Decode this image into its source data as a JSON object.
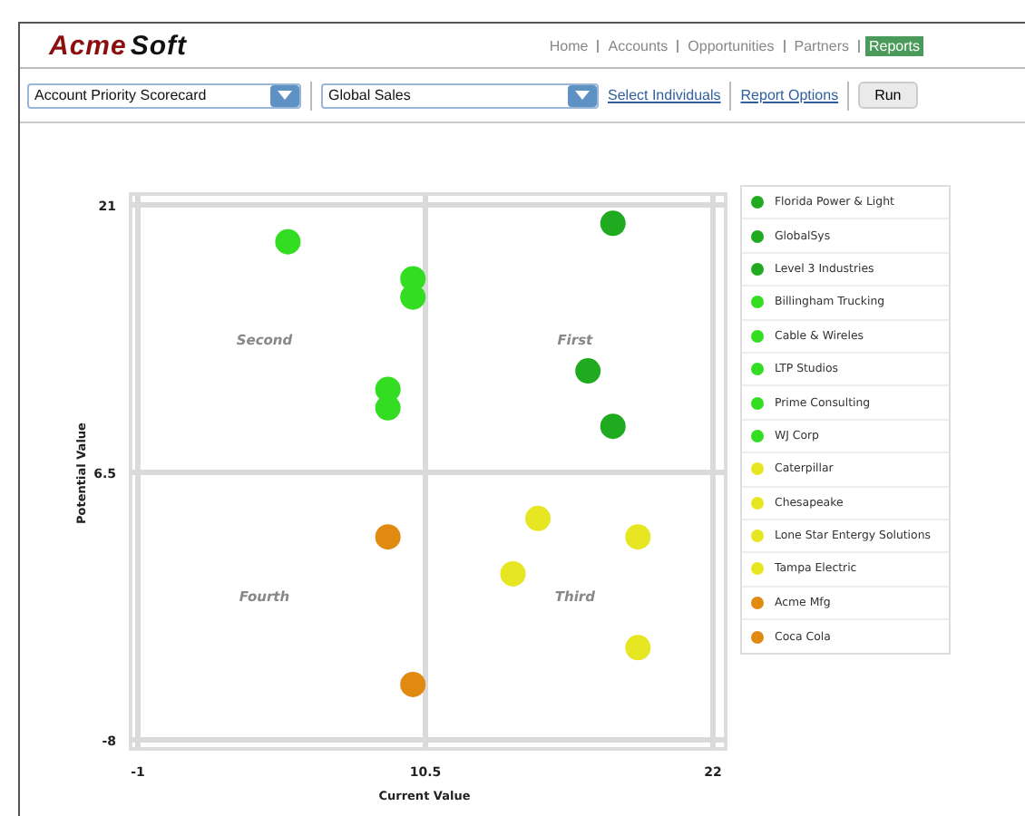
{
  "header": {
    "logo": [
      "Acme",
      "Soft"
    ],
    "nav": [
      {
        "label": "Home",
        "selected": false
      },
      {
        "label": "Accounts",
        "selected": false
      },
      {
        "label": "Opportunities",
        "selected": false
      },
      {
        "label": "Partners",
        "selected": false
      },
      {
        "label": "Reports",
        "selected": true
      }
    ]
  },
  "toolbar": {
    "report_select": {
      "value": "Account Priority Scorecard"
    },
    "scope_select": {
      "value": "Global Sales"
    },
    "links": [
      "Select Individuals",
      "Report Options"
    ],
    "run_button": "Run"
  },
  "chart_data": {
    "type": "scatter",
    "xlabel": "Current Value",
    "ylabel": "Potential Value",
    "xlim": [
      -1,
      22
    ],
    "ylim": [
      -8,
      21
    ],
    "xticks": [
      -1,
      10.5,
      22
    ],
    "yticks": [
      -8,
      6.5,
      21
    ],
    "annotations": [
      "Second",
      "First",
      "Fourth",
      "Third"
    ],
    "series": [
      {
        "name": "Florida Power & Light",
        "color": "#1faa1f",
        "x": [
          18
        ],
        "values": [
          20
        ]
      },
      {
        "name": "GlobalSys",
        "color": "#1faa1f",
        "x": [
          17
        ],
        "values": [
          12
        ]
      },
      {
        "name": "Level 3 Industries",
        "color": "#1faa1f",
        "x": [
          18
        ],
        "values": [
          9
        ]
      },
      {
        "name": "Billingham Trucking",
        "color": "#33dd22",
        "x": [
          5
        ],
        "values": [
          19
        ]
      },
      {
        "name": "Cable & Wireles",
        "color": "#33dd22",
        "x": [
          10
        ],
        "values": [
          17
        ]
      },
      {
        "name": "LTP Studios",
        "color": "#33dd22",
        "x": [
          10
        ],
        "values": [
          16
        ]
      },
      {
        "name": "Prime Consulting",
        "color": "#33dd22",
        "x": [
          9
        ],
        "values": [
          11
        ]
      },
      {
        "name": "WJ Corp",
        "color": "#33dd22",
        "x": [
          9
        ],
        "values": [
          10
        ]
      },
      {
        "name": "Caterpillar",
        "color": "#e6e622",
        "x": [
          15
        ],
        "values": [
          4
        ]
      },
      {
        "name": "Chesapeake",
        "color": "#e6e622",
        "x": [
          19
        ],
        "values": [
          3
        ]
      },
      {
        "name": "Lone Star Entergy Solutions",
        "color": "#e6e622",
        "x": [
          14
        ],
        "values": [
          1
        ]
      },
      {
        "name": "Tampa Electric",
        "color": "#e6e622",
        "x": [
          19
        ],
        "values": [
          -3
        ]
      },
      {
        "name": "Acme Mfg",
        "color": "#e08a12",
        "x": [
          9
        ],
        "values": [
          3
        ]
      },
      {
        "name": "Coca Cola",
        "color": "#e08a12",
        "x": [
          10
        ],
        "values": [
          -5
        ]
      }
    ]
  }
}
